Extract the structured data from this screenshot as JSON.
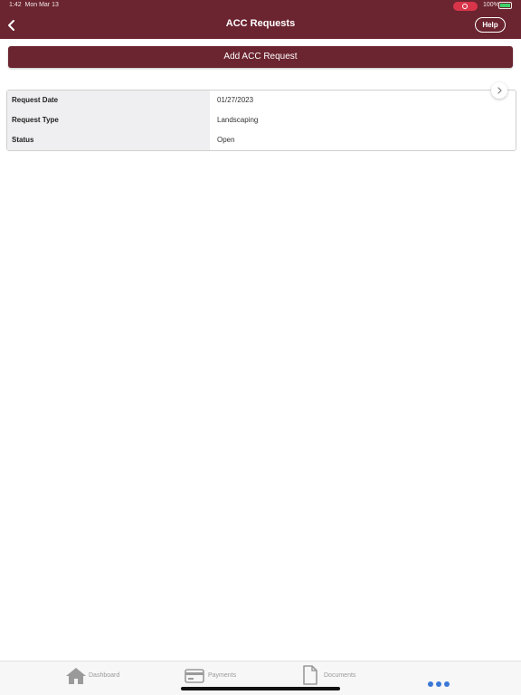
{
  "status_bar": {
    "time": "1:42",
    "date": "Mon Mar 13",
    "battery": "100%"
  },
  "nav": {
    "title": "ACC Requests",
    "help_label": "Help",
    "back_icon": "chevron-left-icon"
  },
  "actions": {
    "add_label": "Add ACC Request"
  },
  "request": {
    "rows": [
      {
        "key": "Request Date",
        "value": "01/27/2023"
      },
      {
        "key": "Request Type",
        "value": "Landscaping"
      },
      {
        "key": "Status",
        "value": "Open"
      }
    ]
  },
  "tabs": [
    {
      "label": "Dashboard",
      "icon": "home-icon"
    },
    {
      "label": "Payments",
      "icon": "card-icon"
    },
    {
      "label": "Documents",
      "icon": "document-icon"
    },
    {
      "label": "",
      "icon": "more-icon"
    }
  ],
  "colors": {
    "brand": "#6b2530",
    "accent": "#3a78d6"
  }
}
